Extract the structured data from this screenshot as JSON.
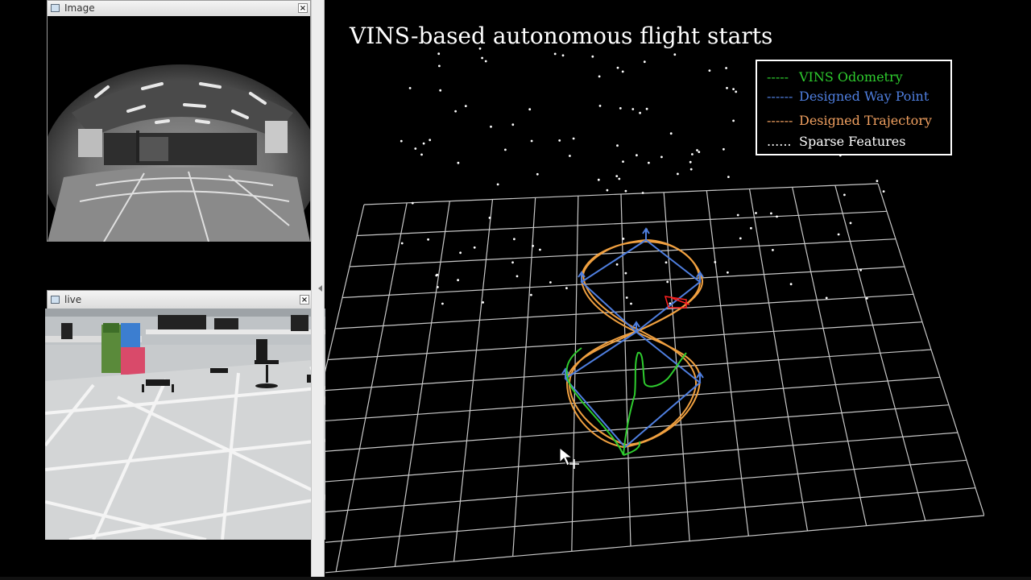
{
  "image_window": {
    "title": "Image",
    "close_glyph": "×",
    "content": "grayscale fisheye camera view of lab"
  },
  "live_window": {
    "title": "live",
    "close_glyph": "×",
    "content": "color video of drone flying in lab"
  },
  "rviz": {
    "headline": "VINS-based autonomous flight starts",
    "legend": [
      {
        "dash": "-----",
        "label": "VINS Odometry",
        "color": "#2ecc2e"
      },
      {
        "dash": "------",
        "label": "Designed Way Point",
        "color": "#4f7fe0"
      },
      {
        "dash": "------",
        "label": "Designed Trajectory",
        "color": "#f0a060"
      },
      {
        "dash": "......",
        "label": "Sparse Features",
        "color": "#ffffff"
      }
    ],
    "colors": {
      "grid": "#c8c8c8",
      "odometry": "#2ecc2e",
      "waypoint": "#4f7fe0",
      "trajectory": "#f0a040",
      "features": "#ffffff",
      "drone_marker": "#ff2020"
    }
  }
}
